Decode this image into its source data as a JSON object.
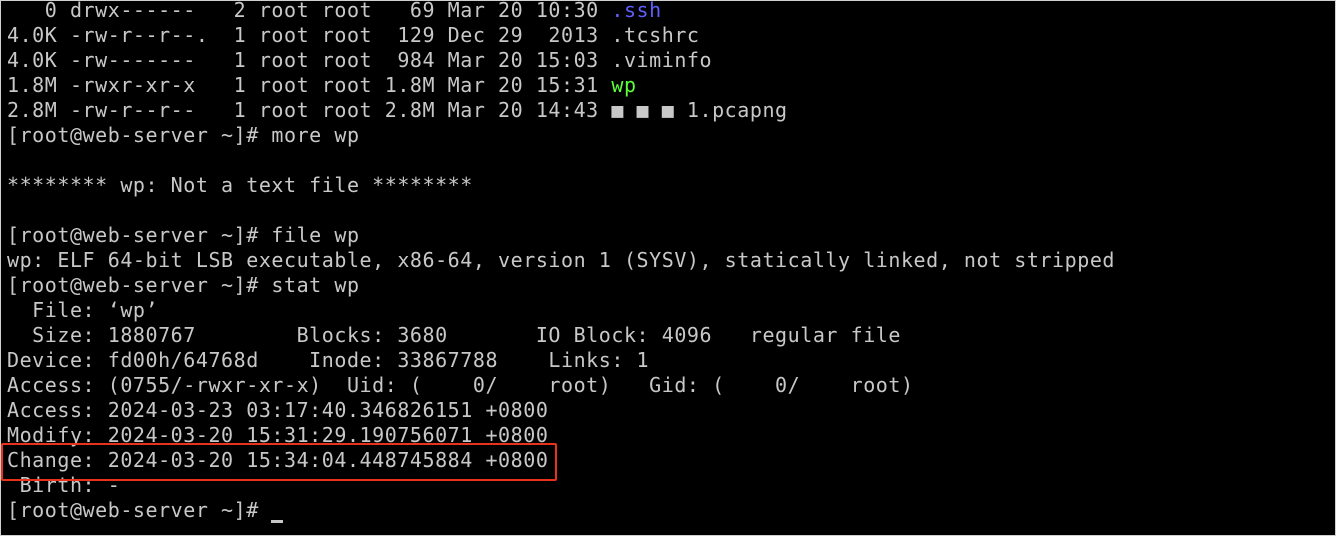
{
  "terminal": {
    "lines": [
      {
        "prefix": "   0 drwx------   2 root root   69 Mar 20 10:30 ",
        "name": ".ssh"
      },
      {
        "text": "4.0K -rw-r--r--.  1 root root  129 Dec 29  2013 .tcshrc"
      },
      {
        "text": "4.0K -rw-------   1 root root  984 Mar 20 15:03 .viminfo"
      },
      {
        "prefix": "1.8M -rwxr-xr-x   1 root root 1.8M Mar 20 15:31 ",
        "name": "wp"
      },
      {
        "text": "2.8M -rw-r--r--   1 root root 2.8M Mar 20 14:43 ■ ■ ■ 1.pcapng"
      },
      {
        "text": "[root@web-server ~]# more wp"
      },
      {
        "text": ""
      },
      {
        "text": "******** wp: Not a text file ********"
      },
      {
        "text": ""
      },
      {
        "text": "[root@web-server ~]# file wp"
      },
      {
        "text": "wp: ELF 64-bit LSB executable, x86-64, version 1 (SYSV), statically linked, not stripped"
      },
      {
        "text": "[root@web-server ~]# stat wp"
      },
      {
        "text": "  File: ‘wp’"
      },
      {
        "text": "  Size: 1880767        Blocks: 3680       IO Block: 4096   regular file"
      },
      {
        "text": "Device: fd00h/64768d    Inode: 33867788    Links: 1"
      },
      {
        "text": "Access: (0755/-rwxr-xr-x)  Uid: (    0/    root)   Gid: (    0/    root)"
      },
      {
        "text": "Access: 2024-03-23 03:17:40.346826151 +0800"
      },
      {
        "text": "Modify: 2024-03-20 15:31:29.190756071 +0800"
      },
      {
        "text": "Change: 2024-03-20 15:34:04.448745884 +0800"
      },
      {
        "text": " Birth: -"
      }
    ],
    "prompt": "[root@web-server ~]# ",
    "colors": {
      "background": "#000000",
      "text": "#c8c8c8",
      "directory": "#5f5fff",
      "executable": "#5dff3a",
      "highlight_border": "#e8321c"
    }
  }
}
